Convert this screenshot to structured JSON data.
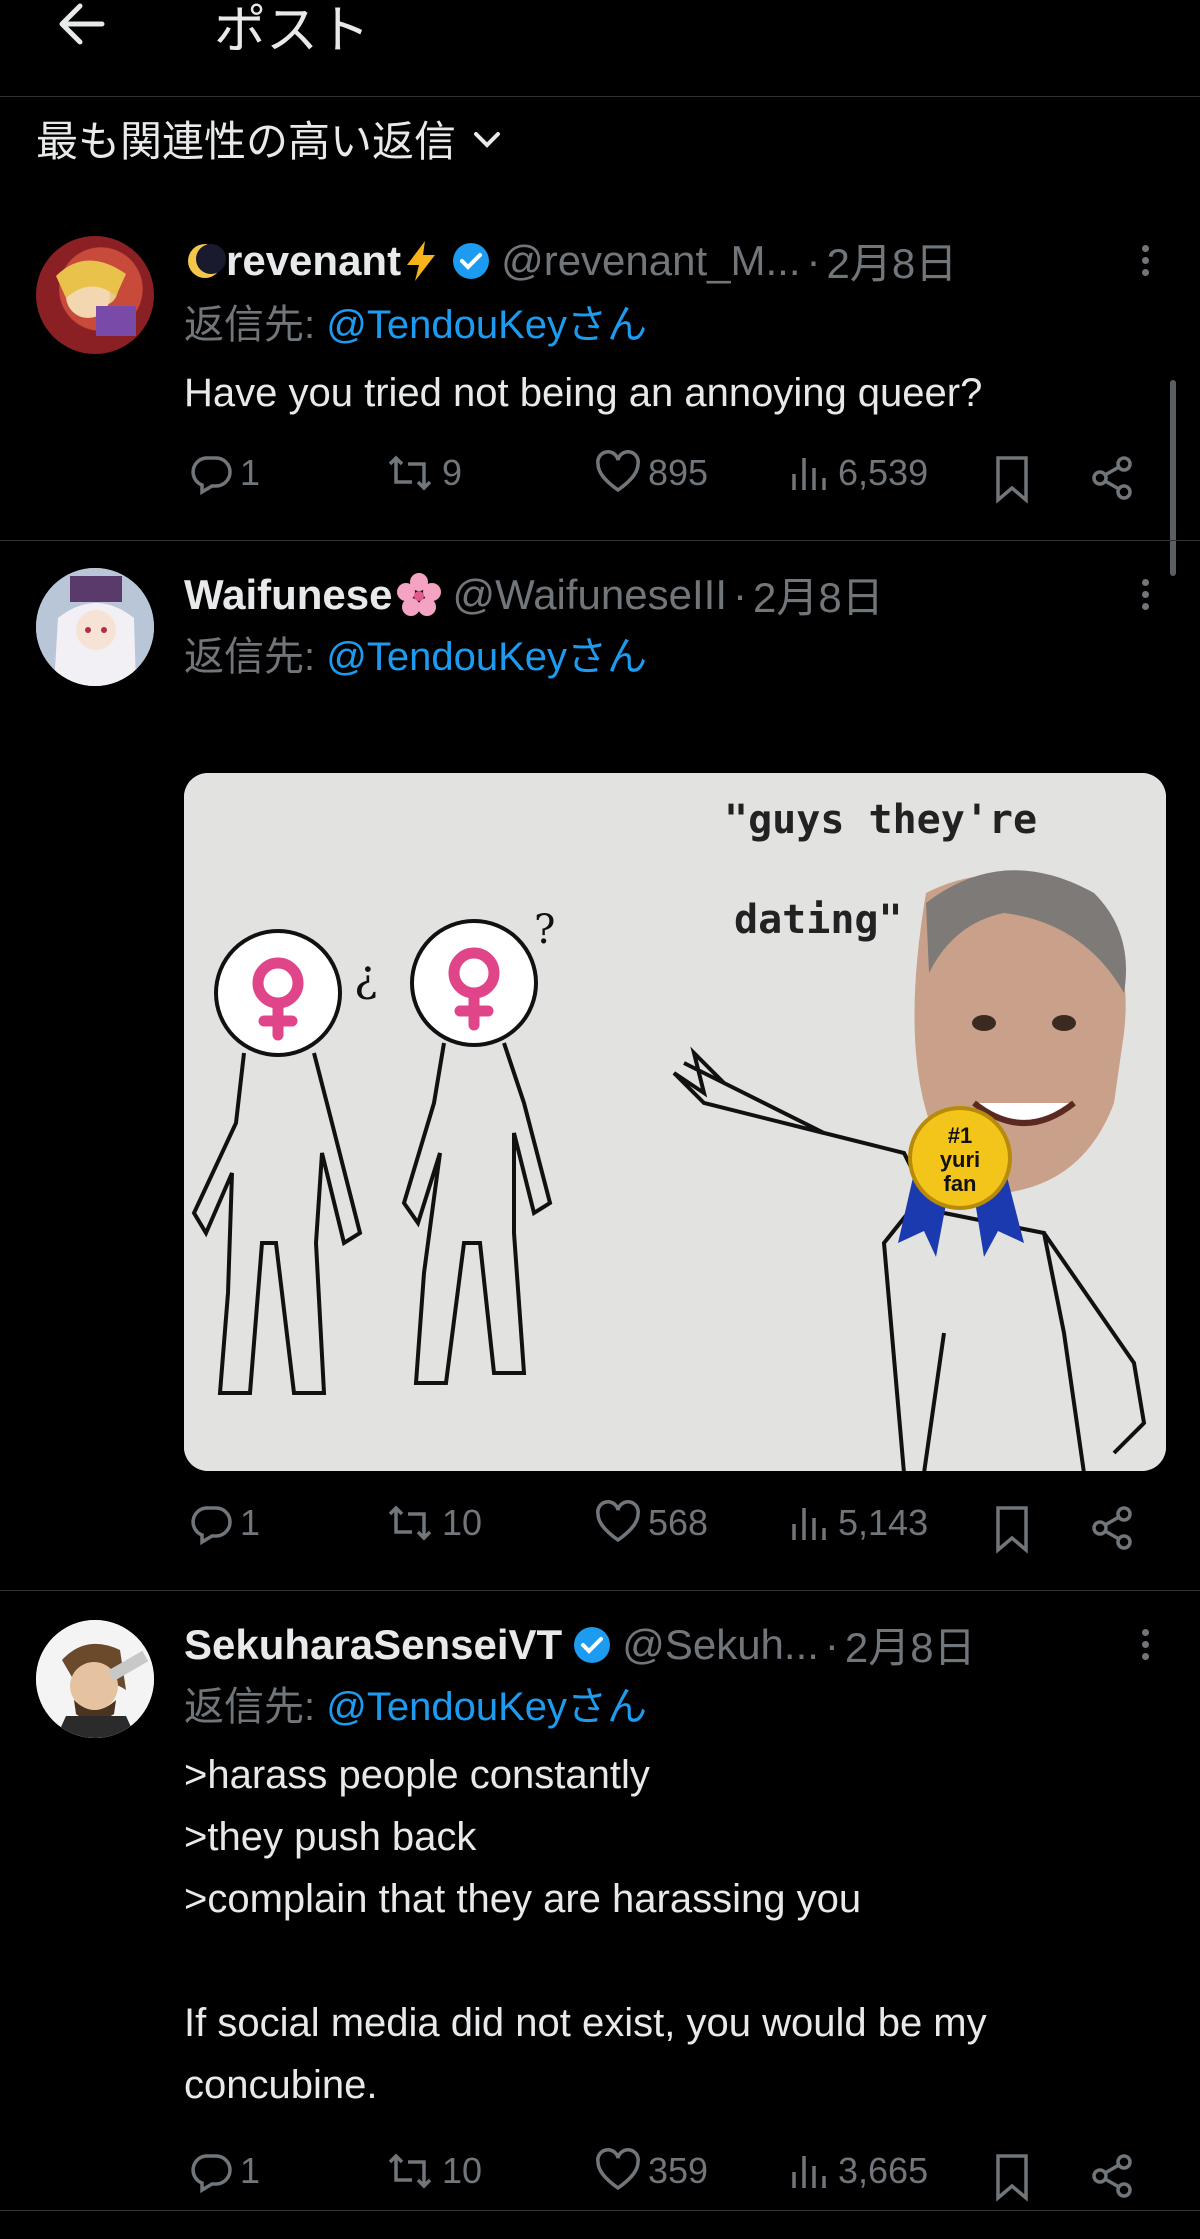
{
  "header": {
    "title": "ポスト"
  },
  "sort": {
    "label": "最も関連性の高い返信"
  },
  "tweets": [
    {
      "name": "revenant",
      "handle": "@revenant_M...",
      "sep": "·",
      "date": "2月8日",
      "reply_prefix": "返信先: ",
      "reply_mention": "@TendouKey",
      "reply_suffix": "さん",
      "text": "Have you tried not being an annoying queer?",
      "replies": "1",
      "retweets": "9",
      "likes": "895",
      "views": "6,539"
    },
    {
      "name": "Waifunese",
      "handle": "@WaifuneseIII",
      "sep": "·",
      "date": "2月8日",
      "reply_prefix": "返信先: ",
      "reply_mention": "@TendouKey",
      "reply_suffix": "さん",
      "replies": "1",
      "retweets": "10",
      "likes": "568",
      "views": "5,143",
      "image": {
        "caption_line1": "\"guys they're",
        "caption_line2": "dating\"",
        "mark_left": "¿",
        "mark_right": "?",
        "badge_line1": "#1",
        "badge_line2": "yuri",
        "badge_line3": "fan"
      }
    },
    {
      "name": "SekuharaSenseiVT",
      "handle": "@Sekuh...",
      "sep": "·",
      "date": "2月8日",
      "reply_prefix": "返信先: ",
      "reply_mention": "@TendouKey",
      "reply_suffix": "さん",
      "text": ">harass people constantly\n>they push back\n>complain that they are harassing you\n\nIf social media did not exist, you would be my concubine.",
      "replies": "1",
      "retweets": "10",
      "likes": "359",
      "views": "3,665"
    }
  ],
  "colors": {
    "link": "#1d9bf0",
    "muted": "#71767b",
    "text": "#e7e9ea",
    "verified": "#1d9bf0"
  }
}
